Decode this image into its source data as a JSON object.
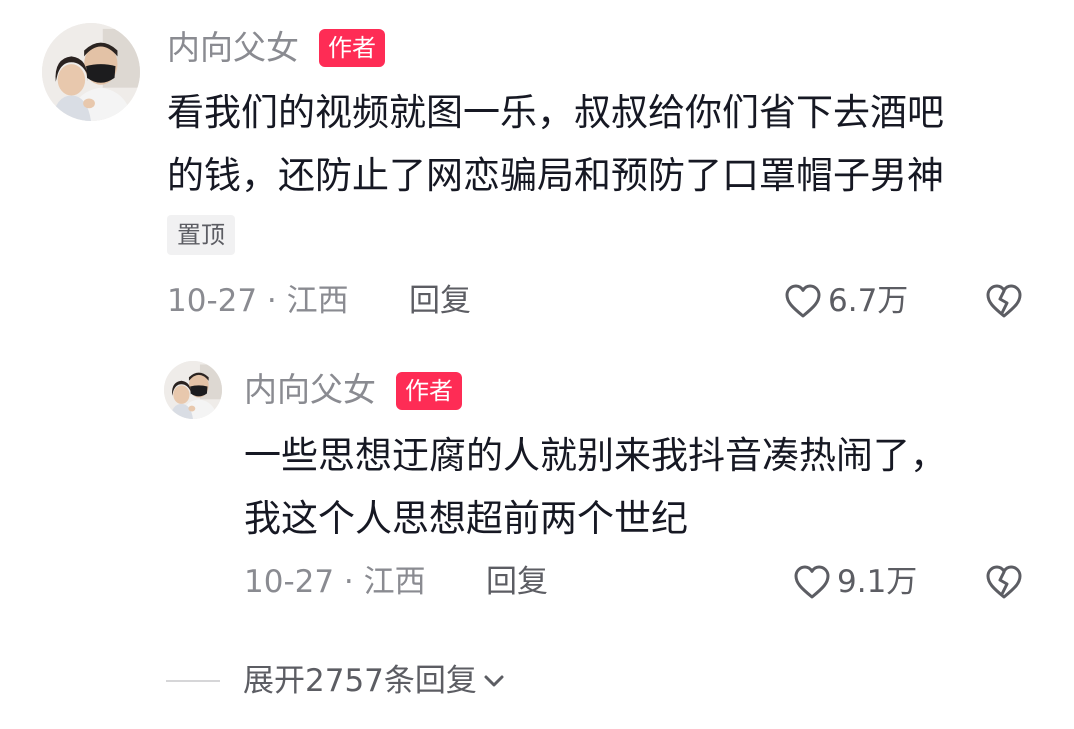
{
  "comment": {
    "author": "内向父女",
    "author_badge": "作者",
    "content_lines": [
      "看我们的视频就图一乐，叔叔给你们省下去酒吧",
      "的钱，还防止了网恋骗局和预防了口罩帽子男神"
    ],
    "pinned_tag": "置顶",
    "date_location": "10-27 · 江西",
    "reply_label": "回复",
    "like_count": "6.7万",
    "avatar_icon": "user-avatar-photo",
    "like_icon": "heart-outline-icon",
    "dislike_icon": "broken-heart-icon"
  },
  "reply": {
    "author": "内向父女",
    "author_badge": "作者",
    "content_lines": [
      "一些思想迂腐的人就别来我抖音凑热闹了，",
      "我这个人思想超前两个世纪"
    ],
    "date_location": "10-27 · 江西",
    "reply_label": "回复",
    "like_count": "9.1万",
    "avatar_icon": "user-avatar-photo",
    "like_icon": "heart-outline-icon",
    "dislike_icon": "broken-heart-icon"
  },
  "expand_replies": {
    "label": "展开2757条回复",
    "icon": "chevron-down-icon"
  },
  "colors": {
    "badge_bg": "#fe2c55",
    "muted_text": "#8a8b91",
    "secondary_text": "#5c5d63",
    "primary_text": "#161823",
    "tag_bg": "#f1f1f2"
  }
}
